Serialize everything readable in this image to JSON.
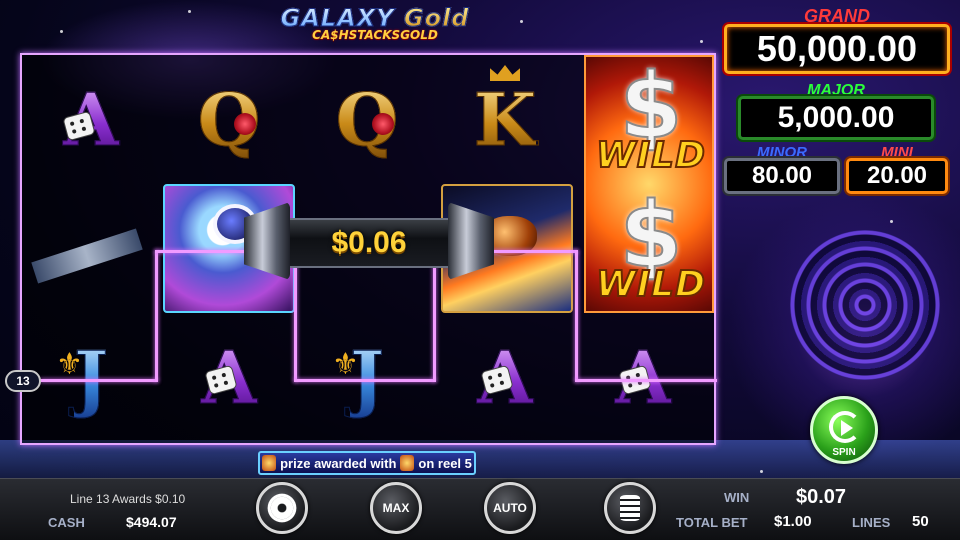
{
  "logo": {
    "line1_a": "GALAXY",
    "line1_b": "Gold",
    "line2": "CA$HSTACKSGOLD"
  },
  "jackpots": {
    "grand": {
      "label": "GRAND",
      "value": "50,000.00"
    },
    "major": {
      "label": "MAJOR",
      "value": "5,000.00"
    },
    "minor": {
      "label": "MINOR",
      "value": "80.00"
    },
    "mini": {
      "label": "MINI",
      "value": "20.00"
    }
  },
  "reels": {
    "row1": [
      "A",
      "Q",
      "Q",
      "K"
    ],
    "row3": [
      "J",
      "A",
      "J",
      "A",
      "A"
    ],
    "wild_label": "WILD",
    "wild_symbol": "$"
  },
  "win_banner": "$0.06",
  "payline_number": "13",
  "info_strip": {
    "part1": "prize awarded with",
    "part2": "on reel 5"
  },
  "spin_button": "SPIN",
  "bottom": {
    "line_award": "Line 13 Awards $0.10",
    "cash_label": "CASH",
    "cash_value": "$494.07",
    "max_label": "MAX",
    "auto_label": "AUTO",
    "win_label": "WIN",
    "win_value": "$0.07",
    "total_bet_label": "TOTAL BET",
    "total_bet_value": "$1.00",
    "lines_label": "LINES",
    "lines_value": "50"
  },
  "colors": {
    "grand": "#ff3a3a",
    "major": "#2aff3a",
    "minor": "#3a6aff",
    "mini": "#ff4a4a",
    "payline": "#f19bff",
    "win_amount": "#ffd23a"
  },
  "icons": [
    "gear-icon",
    "max-bet-icon",
    "autoplay-icon",
    "coin-stack-icon",
    "spin-icon",
    "dice-icon",
    "rose-icon",
    "crown-icon",
    "fleur-de-lis-icon"
  ]
}
